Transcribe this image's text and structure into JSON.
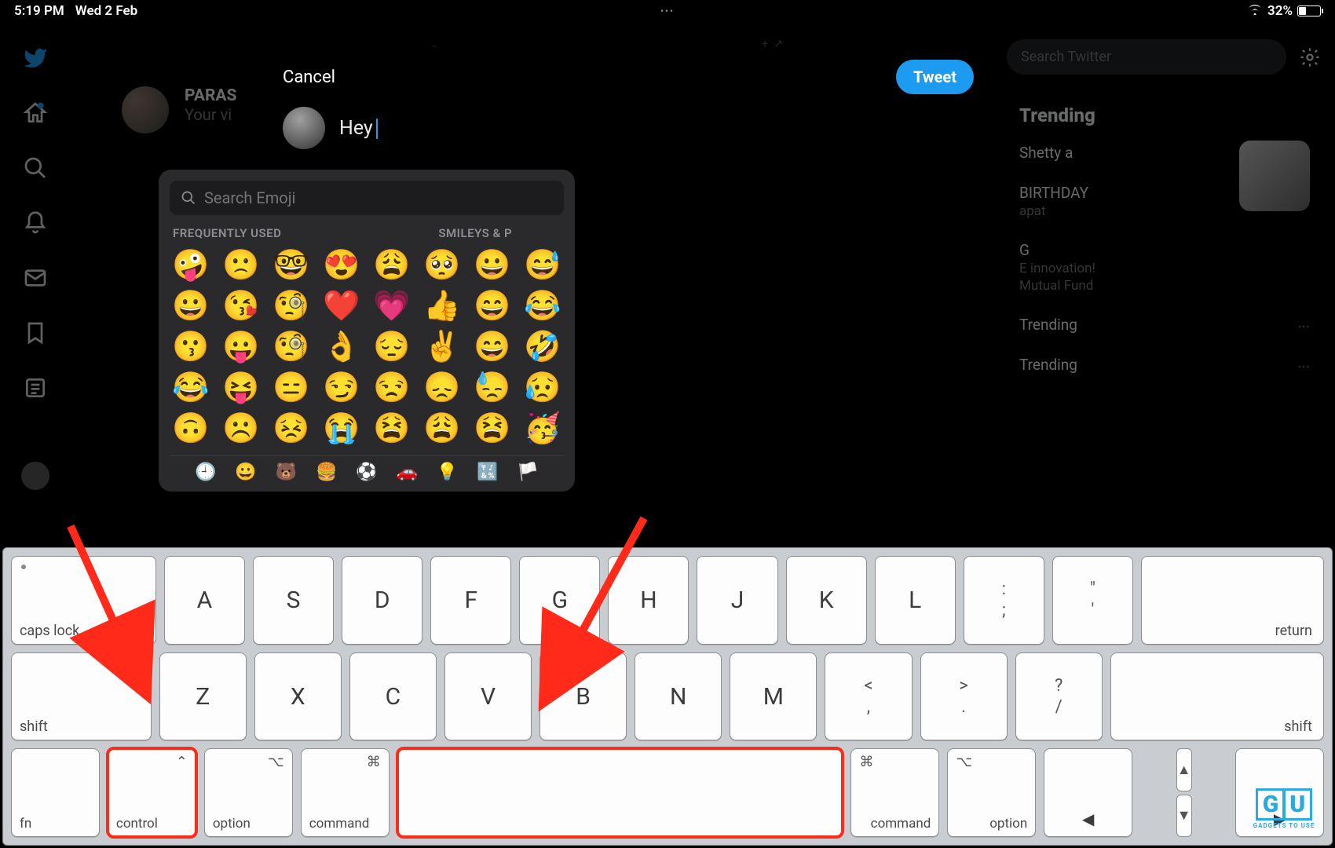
{
  "status": {
    "time": "5:19 PM",
    "date": "Wed 2 Feb",
    "center_dots": "•••",
    "battery_pct": "32%"
  },
  "top_icons": {
    "a": "‥",
    "b": "+ ↗"
  },
  "search": {
    "placeholder": "Search Twitter"
  },
  "trending": {
    "heading": "Trending",
    "items": [
      {
        "t1": "Shetty a",
        "t2": ""
      },
      {
        "t1": "BIRTHDAY",
        "t2": "apat"
      },
      {
        "t1": "G",
        "t2": "E innovation!"
      },
      {
        "t1": "",
        "t2": "Mutual Fund"
      },
      {
        "t1": "Trending",
        "t2": "",
        "more": "···"
      },
      {
        "t1": "Trending",
        "t2": "",
        "more": "···"
      }
    ]
  },
  "feed": {
    "name": "PARAS",
    "sub": "Your vi"
  },
  "modal": {
    "cancel": "Cancel",
    "tweet": "Tweet",
    "compose_text": "Hey"
  },
  "emoji": {
    "search_placeholder": "Search Emoji",
    "label_frequent": "FREQUENTLY USED",
    "label_smileys": "SMILEYS & P",
    "grid": [
      [
        "🤪",
        "🙁",
        "🤓",
        "😍",
        "😩",
        "🥺",
        "😀",
        "😅"
      ],
      [
        "😀",
        "😘",
        "🧐",
        "❤️",
        "💗",
        "👍",
        "😄",
        "😂"
      ],
      [
        "😗",
        "😛",
        "🧐",
        "👌",
        "😔",
        "✌️",
        "😄",
        "🤣"
      ],
      [
        "😂",
        "😝",
        "😑",
        "😏",
        "😒",
        "😞",
        "😓",
        "😥"
      ],
      [
        "🙃",
        "☹️",
        "😣",
        "😭",
        "😫",
        "😩",
        "😫",
        "🥳"
      ]
    ],
    "tabs": [
      "🕘",
      "😀",
      "🐻",
      "🍔",
      "⚽",
      "🚗",
      "💡",
      "🔣",
      "🏳️"
    ]
  },
  "keyboard": {
    "row1": {
      "caps": "caps lock",
      "letters": [
        "A",
        "S",
        "D",
        "F",
        "G",
        "H",
        "J",
        "K",
        "L"
      ],
      "punct": [
        {
          "top": ":",
          "bot": ";"
        },
        {
          "top": "\"",
          "bot": "'"
        }
      ],
      "return": "return"
    },
    "row2": {
      "shift": "shift",
      "letters": [
        "Z",
        "X",
        "C",
        "V",
        "B",
        "N",
        "M"
      ],
      "punct": [
        {
          "top": "<",
          "bot": ","
        },
        {
          "top": ">",
          "bot": "."
        },
        {
          "top": "?",
          "bot": "/"
        }
      ],
      "shift_r": "shift"
    },
    "row3": {
      "fn": "fn",
      "control": {
        "sym": "⌃",
        "label": "control"
      },
      "option_l": {
        "sym": "⌥",
        "label": "option"
      },
      "command_l": {
        "sym": "⌘",
        "label": "command"
      },
      "space": "",
      "command_r": {
        "sym": "⌘",
        "label": "command"
      },
      "option_r": {
        "sym": "⌥",
        "label": "option"
      }
    }
  },
  "watermark": {
    "brand": "GU",
    "tag": "GADGETS TO USE"
  }
}
